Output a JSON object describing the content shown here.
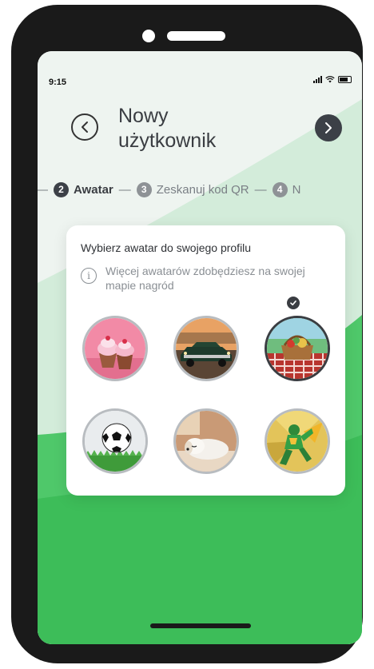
{
  "status": {
    "time": "9:15"
  },
  "header": {
    "title_line1": "Nowy",
    "title_line2": "użytkownik"
  },
  "stepper": [
    {
      "num": "2",
      "label": "Awatar",
      "active": true
    },
    {
      "num": "3",
      "label": "Zeskanuj kod QR",
      "active": false
    },
    {
      "num": "4",
      "label": "N",
      "active": false
    }
  ],
  "card": {
    "title": "Wybierz awatar do swojego profilu",
    "info": "Więcej awatarów zdobędziesz na swojej mapie nagród"
  },
  "avatars": [
    {
      "name": "cupcakes",
      "selected": false
    },
    {
      "name": "vintage-car",
      "selected": false
    },
    {
      "name": "picnic-basket",
      "selected": true
    },
    {
      "name": "soccer-ball",
      "selected": false
    },
    {
      "name": "sleeping-dog",
      "selected": false
    },
    {
      "name": "superhero",
      "selected": false
    }
  ],
  "colors": {
    "accent_green": "#3fbf5c",
    "light_green": "#d9efe0",
    "dark": "#3c4047"
  }
}
